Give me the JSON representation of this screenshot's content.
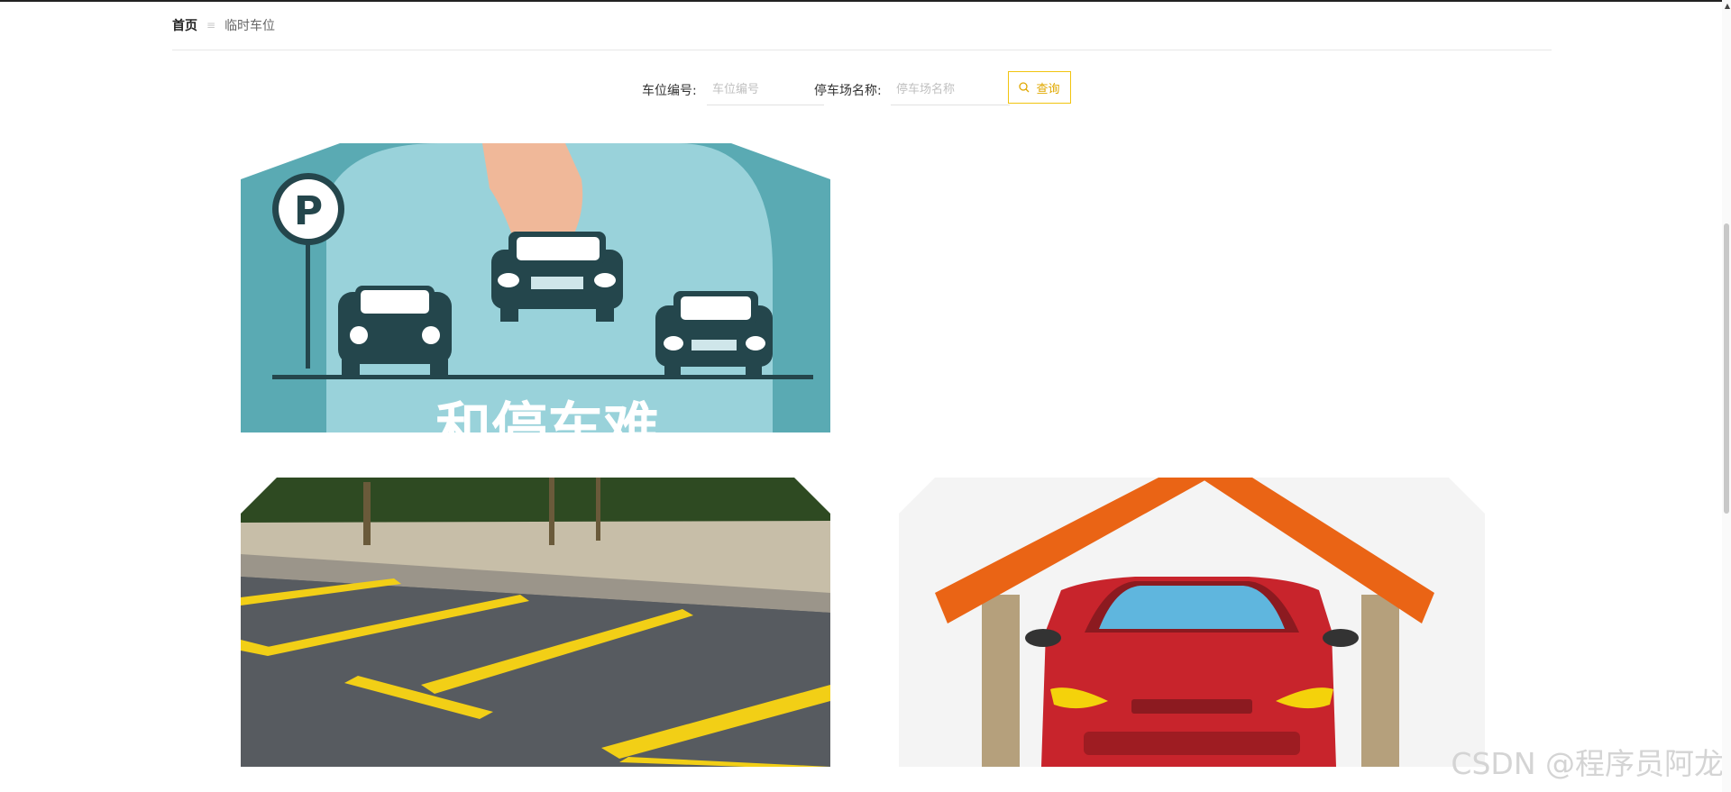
{
  "breadcrumb": {
    "home": "首页",
    "separator": "≡",
    "current": "临时车位"
  },
  "search": {
    "space_no_label": "车位编号:",
    "space_no_placeholder": "车位编号",
    "lot_name_label": "停车场名称:",
    "lot_name_placeholder": "停车场名称",
    "button_label": "查询",
    "button_icon": "search-icon"
  },
  "cards": [
    {
      "name": "parking-illustration-card",
      "banner_text": "和停车难"
    },
    {
      "name": "parking-lot-photo-card"
    },
    {
      "name": "car-garage-illustration-card"
    }
  ],
  "watermark": "CSDN @程序员阿龙",
  "colors": {
    "accent": "#f1c40f",
    "teal": "#5aaab3",
    "orange": "#ea6415",
    "car_red": "#c8242c"
  }
}
